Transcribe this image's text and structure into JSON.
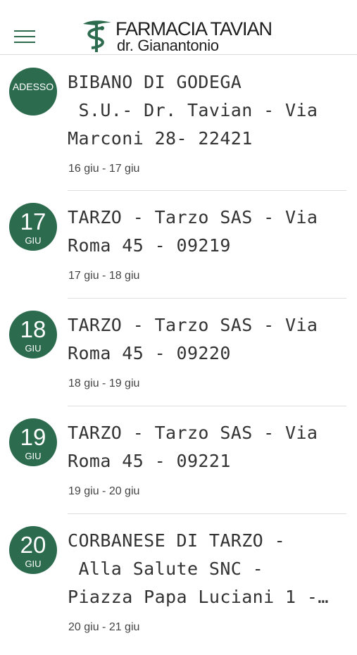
{
  "header": {
    "logo_title": "FARMACIA TAVIAN",
    "logo_subtitle": "dr. Gianantonio",
    "accent_color": "#2c6b4e"
  },
  "items": [
    {
      "badge_text": "ADESSO",
      "name": "BIBANO DI GODEGA\n S.U.- Dr. Tavian - Via\nMarconi 28- 22421",
      "range": "16 giu - 17 giu"
    },
    {
      "day": "17",
      "month": "GIU",
      "name": "TARZO - Tarzo SAS - Via\nRoma 45 - 09219",
      "range": "17 giu - 18 giu"
    },
    {
      "day": "18",
      "month": "GIU",
      "name": "TARZO - Tarzo SAS - Via\nRoma 45 - 09220",
      "range": "18 giu - 19 giu"
    },
    {
      "day": "19",
      "month": "GIU",
      "name": "TARZO - Tarzo SAS - Via\nRoma 45 - 09221",
      "range": "19 giu - 20 giu"
    },
    {
      "day": "20",
      "month": "GIU",
      "name": "CORBANESE DI TARZO -\n Alla Salute SNC -\nPiazza Papa Luciani 1 -…",
      "range": "20 giu - 21 giu"
    }
  ]
}
